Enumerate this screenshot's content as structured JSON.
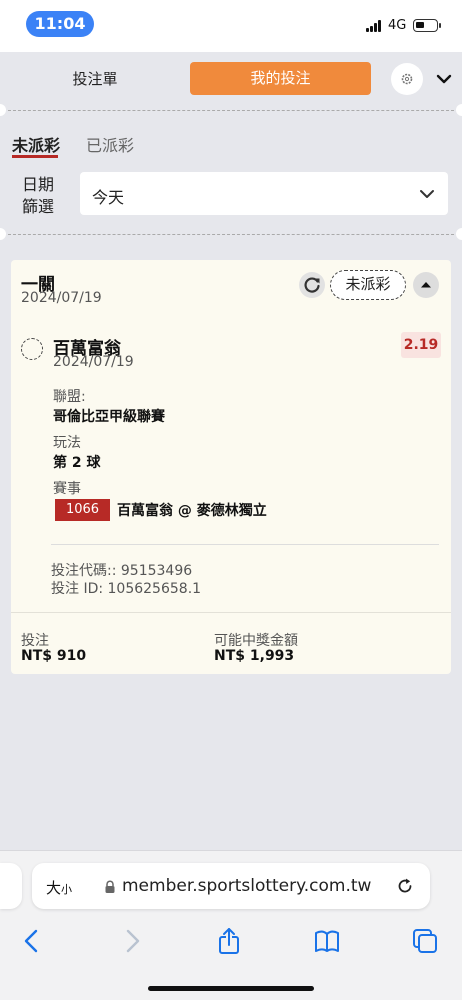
{
  "status_bar": {
    "time": "11:04",
    "network": "4G"
  },
  "header": {
    "tab_slip": "投注單",
    "tab_my_bets": "我的投注"
  },
  "sub_tabs": {
    "unsettled": "未派彩",
    "settled": "已派彩"
  },
  "date_filter": {
    "label": "日期篩選",
    "value": "今天"
  },
  "bet": {
    "type": "一關",
    "date": "2024/07/19",
    "status": "未派彩",
    "selection": "百萬富翁",
    "selection_date": "2024/07/19",
    "odds": "2.19",
    "league_label": "聯盟:",
    "league": "哥倫比亞甲級聯賽",
    "market_label": "玩法",
    "market": "第 2 球",
    "event_label": "賽事",
    "event_number": "1066",
    "event": "百萬富翁 @ 麥德林獨立",
    "code_line": "投注代碼:: 95153496",
    "id_line": "投注 ID: 105625658.1",
    "stake_label": "投注",
    "stake": "NT$ 910",
    "payout_label": "可能中獎金額",
    "payout": "NT$ 1,993"
  },
  "browser": {
    "text_size": "大",
    "text_size_small": "小",
    "url": "member.sportslottery.com.tw"
  },
  "colors": {
    "accent": "#f08a3c",
    "brand_red": "#b72a26",
    "card_bg": "#fcfaf0"
  }
}
